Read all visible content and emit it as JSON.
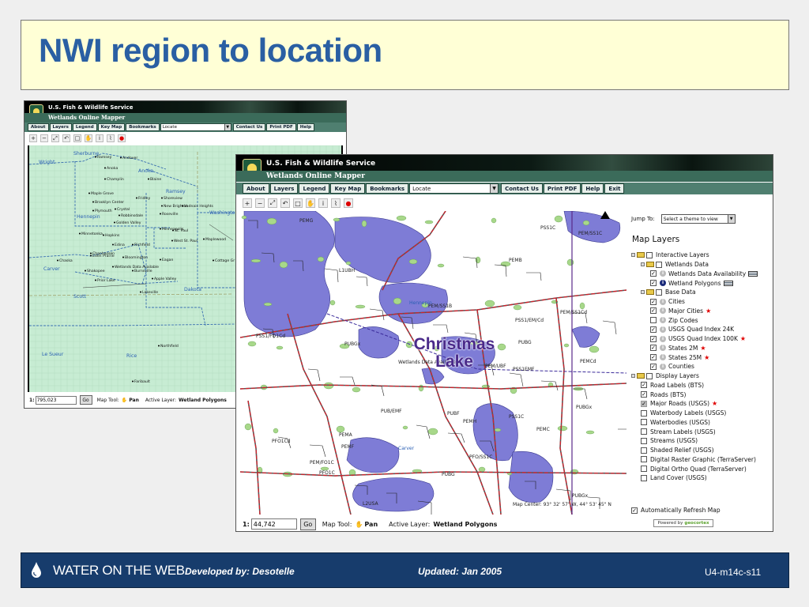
{
  "slide": {
    "title": "NWI region to location",
    "christmas_label": "Christmas Lake"
  },
  "header": {
    "agency": "U.S. Fish & Wildlife Service",
    "app_title": "Wetlands Online Mapper"
  },
  "menu": {
    "items": [
      "About",
      "Layers",
      "Legend",
      "Key Map",
      "Bookmarks"
    ],
    "locate": "Locate",
    "right_items": [
      "Contact Us",
      "Print PDF",
      "Help"
    ],
    "exit": "Exit"
  },
  "toolbar": {
    "icons": [
      "zoom-in-icon",
      "zoom-out-icon",
      "full-extent-icon",
      "zoom-previous-icon",
      "zoom-box-icon",
      "pan-hand-icon",
      "identify-icon",
      "measure-icon",
      "redline-icon"
    ]
  },
  "map1": {
    "scale": "795,023",
    "place_labels": [
      "Sherburne",
      "Wright",
      "Ramsey",
      "Andover",
      "Anoka",
      "Anoka",
      "Blaine",
      "Champlin",
      "Maple Grove",
      "Brooklyn Center",
      "Fridley",
      "Shoreview",
      "New Brighton",
      "Vadnais Heights",
      "Ramsey",
      "Plymouth",
      "Crystal",
      "Robbinsdale",
      "Golden Valley",
      "Roseville",
      "Hennepin",
      "Washington",
      "Minneapolis",
      "Minnetonka",
      "Hopkins",
      "St. Paul",
      "West St. Paul",
      "Maplewood",
      "Woodbury",
      "Edina",
      "Richfield",
      "Chanhassen",
      "Eden Prairie",
      "Bloomington",
      "Eagan",
      "Chaska",
      "Shakopee",
      "Burnsville",
      "Wetlands Data Available",
      "Cottage Gr",
      "Carver",
      "Prior Lake",
      "Apple Valley",
      "Scott",
      "Lakeville",
      "Dakota",
      "Northfield",
      "Le Sueur",
      "Rice",
      "Faribault"
    ]
  },
  "map2": {
    "scale": "44,742",
    "coord": "Map Center: 93° 32' 57\" W, 44° 53' 45\" N",
    "wetland_codes": [
      "PEMG",
      "PSS1C",
      "PEM/SS1C",
      "L1UBH",
      "PEMB",
      "PEM/SS1B",
      "Hennepin",
      "PEM/SS1Cd",
      "PSS1/EM/Cd",
      "PSS1/FO1Cd",
      "PUBGx",
      "PUBG",
      "PEM/UBF",
      "PSS1EMF",
      "PEMCd",
      "Wetlands Data Available",
      "PUB/EMF",
      "PUBF",
      "PSS1C",
      "PUBGx",
      "PEMH",
      "PEMC",
      "PEMA",
      "PFO1Cd",
      "PEMF",
      "Carver",
      "PEM/FO1C",
      "PFO1C",
      "PFO/SS1C",
      "PUBG",
      "L2USA",
      "PUBGx"
    ]
  },
  "status": {
    "scale_prefix": "1:",
    "go": "Go",
    "map_tool_label": "Map Tool:",
    "map_tool": "Pan",
    "active_layer_label": "Active Layer:",
    "active_layer": "Wetland Polygons"
  },
  "panel": {
    "jump_label": "Jump To:",
    "jump_placeholder": "Select a theme to view",
    "title": "Map Layers",
    "layers": [
      {
        "label": "Interactive Layers",
        "level": 0,
        "group": true,
        "checked": false
      },
      {
        "label": "Wetlands Data",
        "level": 1,
        "group": true,
        "checked": false
      },
      {
        "label": "Wetlands Data Availability",
        "level": 2,
        "checked": true,
        "info": true,
        "legend": true
      },
      {
        "label": "Wetland Polygons",
        "level": 2,
        "checked": true,
        "info": true,
        "active": true,
        "legend": true
      },
      {
        "label": "Base Data",
        "level": 1,
        "group": true,
        "checked": false
      },
      {
        "label": "Cities",
        "level": 2,
        "checked": true,
        "info": true
      },
      {
        "label": "Major Cities",
        "level": 2,
        "checked": true,
        "info": true,
        "star": true
      },
      {
        "label": "Zip Codes",
        "level": 2,
        "checked": false,
        "info": true
      },
      {
        "label": "USGS Quad Index 24K",
        "level": 2,
        "checked": true,
        "info": true
      },
      {
        "label": "USGS Quad Index 100K",
        "level": 2,
        "checked": true,
        "info": true,
        "star": true
      },
      {
        "label": "States 2M",
        "level": 2,
        "checked": true,
        "info": true,
        "star": true
      },
      {
        "label": "States 25M",
        "level": 2,
        "checked": true,
        "info": true,
        "star": true
      },
      {
        "label": "Counties",
        "level": 2,
        "checked": true,
        "info": true
      },
      {
        "label": "Display Layers",
        "level": 0,
        "group": true,
        "checked": false
      },
      {
        "label": "Road Labels (BTS)",
        "level": 1,
        "checked": true
      },
      {
        "label": "Roads (BTS)",
        "level": 1,
        "checked": true
      },
      {
        "label": "Major Roads (USGS)",
        "level": 1,
        "checked": true,
        "disabled": true,
        "star": true
      },
      {
        "label": "Waterbody Labels (USGS)",
        "level": 1,
        "checked": false
      },
      {
        "label": "Waterbodies (USGS)",
        "level": 1,
        "checked": false
      },
      {
        "label": "Stream Labels (USGS)",
        "level": 1,
        "checked": false
      },
      {
        "label": "Streams (USGS)",
        "level": 1,
        "checked": false
      },
      {
        "label": "Shaded Relief (USGS)",
        "level": 1,
        "checked": false
      },
      {
        "label": "Digital Raster Graphic (TerraServer)",
        "level": 1,
        "checked": false
      },
      {
        "label": "Digital Ortho Quad (TerraServer)",
        "level": 1,
        "checked": false
      },
      {
        "label": "Land Cover (USGS)",
        "level": 1,
        "checked": false
      }
    ],
    "auto_refresh": "Automatically Refresh Map",
    "powered_by": "Powered by",
    "powered_brand": "geocortex"
  },
  "footer": {
    "brand": "WATER ON THE WEB",
    "developed": "Developed by:  Desotelle",
    "updated": "Updated: Jan 2005",
    "slide_id": "U4-m14c-s11"
  },
  "colors": {
    "title": "#2a5fa3",
    "title_bg": "#ffffd6",
    "footer_bg": "#173c6c",
    "menu_bar": "#4f7f70",
    "wetland_fill": "#7e7cd6",
    "map1_fill": "#c7ecd3",
    "road": "#d4202a"
  }
}
